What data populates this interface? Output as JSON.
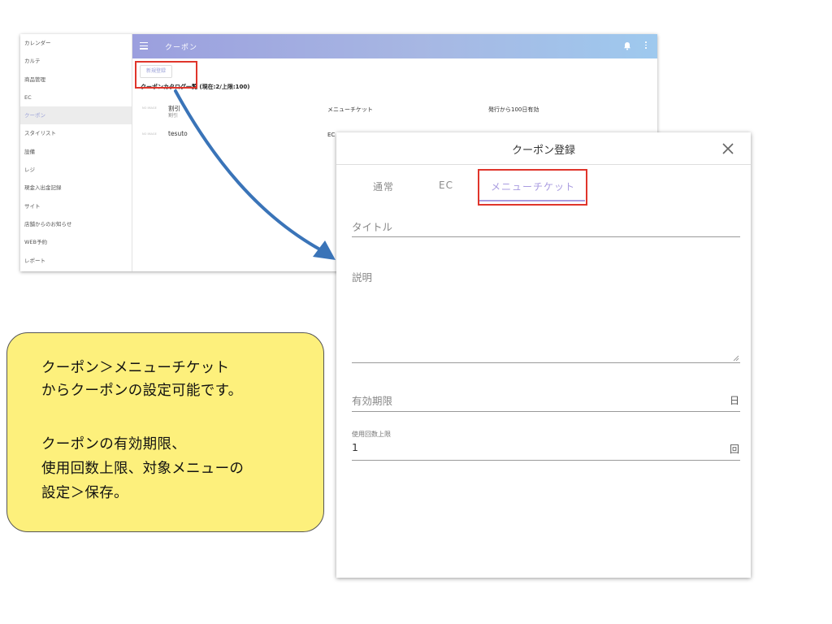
{
  "sidebar": {
    "items": [
      {
        "label": "カレンダー",
        "active": false
      },
      {
        "label": "カルテ",
        "active": false
      },
      {
        "label": "商品管理",
        "active": false
      },
      {
        "label": "EC",
        "active": false
      },
      {
        "label": "クーポン",
        "active": true
      },
      {
        "label": "スタイリスト",
        "active": false
      },
      {
        "label": "設備",
        "active": false
      },
      {
        "label": "レジ",
        "active": false
      },
      {
        "label": "現金入出金記録",
        "active": false
      },
      {
        "label": "サイト",
        "active": false
      },
      {
        "label": "店舗からのお知らせ",
        "active": false
      },
      {
        "label": "WEB予約",
        "active": false
      },
      {
        "label": "レポート",
        "active": false
      }
    ]
  },
  "topbar": {
    "title": "クーポン",
    "gradient": [
      "#9b9fde",
      "#9ec9ee"
    ]
  },
  "main": {
    "new_button_label": "新規登録",
    "catalog_heading": "クーポンカタログ一覧 (現在:2/上限:100)",
    "coupons": [
      {
        "thumb": "NO IMAGE",
        "name": "割引",
        "sub": "割引",
        "type": "メニューチケット",
        "expiry": "発行から100日有効"
      },
      {
        "thumb": "NO IMAGE",
        "name": "tesuto",
        "sub": "",
        "type": "EC",
        "expiry": ""
      }
    ]
  },
  "dialog": {
    "title": "クーポン登録",
    "close_icon": "close-icon",
    "tabs": [
      {
        "label": "通常",
        "active": false
      },
      {
        "label": "EC",
        "active": false
      },
      {
        "label": "メニューチケット",
        "active": true
      }
    ],
    "fields": {
      "title_label": "タイトル",
      "description_label": "説明",
      "expiry_label": "有効期限",
      "expiry_unit": "日",
      "usage_label": "使用回数上限",
      "usage_value": "1",
      "usage_unit": "回"
    }
  },
  "note": {
    "lines": [
      "クーポン＞メニューチケット",
      "からクーポンの設定可能です。",
      "",
      "クーポンの有効期限、",
      "使用回数上限、対象メニューの",
      "設定＞保存。"
    ]
  },
  "colors": {
    "highlight": "#e0352b",
    "arrow": "#3a74b8",
    "note_bg": "#fdf07c",
    "accent": "#a99ce0"
  }
}
